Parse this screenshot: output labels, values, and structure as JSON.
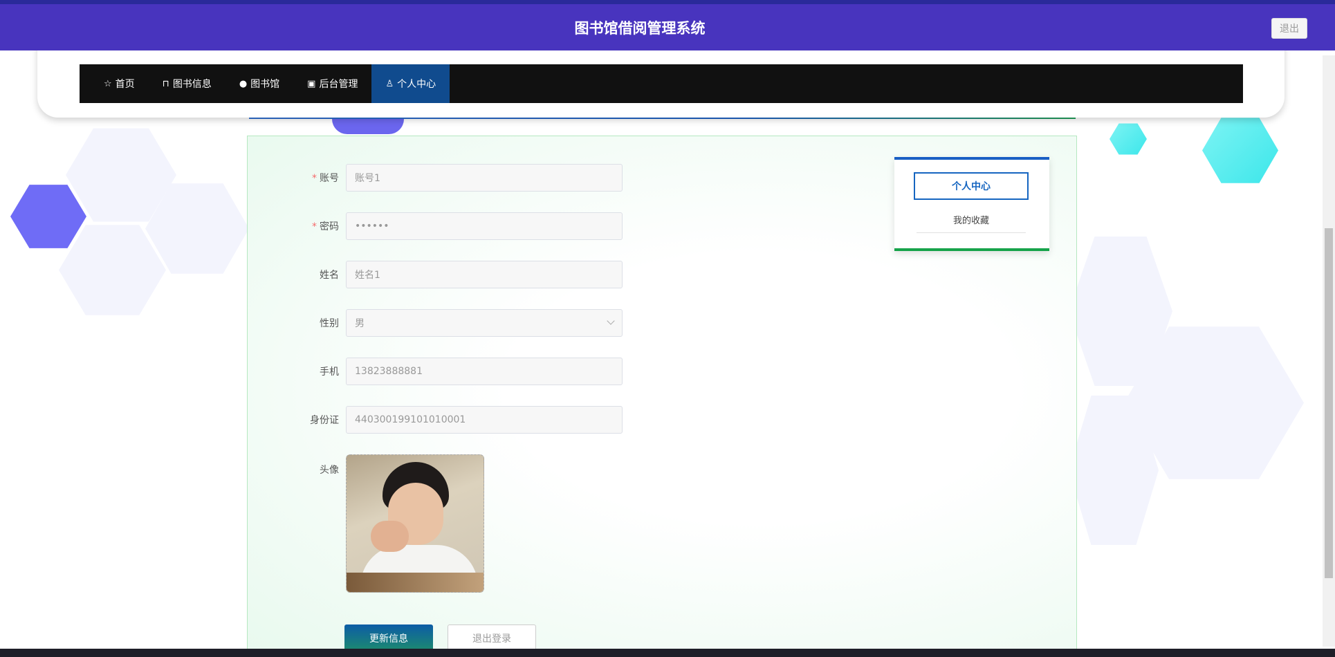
{
  "header": {
    "title": "图书馆借阅管理系统",
    "logout_label": "退出"
  },
  "nav": {
    "items": [
      {
        "icon": "star-icon",
        "glyph": "☆",
        "label": "首页",
        "active": false
      },
      {
        "icon": "bag-icon",
        "glyph": "⊓",
        "label": "图书信息",
        "active": false
      },
      {
        "icon": "info-icon",
        "glyph": "●",
        "label": "图书馆",
        "active": false
      },
      {
        "icon": "briefcase-icon",
        "glyph": "▣",
        "label": "后台管理",
        "active": false
      },
      {
        "icon": "user-icon",
        "glyph": "♙",
        "label": "个人中心",
        "active": true
      }
    ]
  },
  "form": {
    "account": {
      "label": "账号",
      "required": true,
      "value": "账号1"
    },
    "password": {
      "label": "密码",
      "required": true,
      "value": "••••••"
    },
    "name": {
      "label": "姓名",
      "required": false,
      "value": "姓名1"
    },
    "gender": {
      "label": "性别",
      "required": false,
      "value": "男"
    },
    "phone": {
      "label": "手机",
      "required": false,
      "value": "13823888881"
    },
    "id_card": {
      "label": "身份证",
      "required": false,
      "value": "440300199101010001"
    },
    "avatar": {
      "label": "头像"
    },
    "update_label": "更新信息",
    "logout_label": "退出登录"
  },
  "side_menu": {
    "active_label": "个人中心",
    "favorites_label": "我的收藏"
  },
  "colors": {
    "header_bg": "#4834be",
    "nav_bg": "#111111",
    "nav_active": "#104b8e",
    "accent_blue": "#1565c0",
    "accent_green": "#16a34a"
  }
}
